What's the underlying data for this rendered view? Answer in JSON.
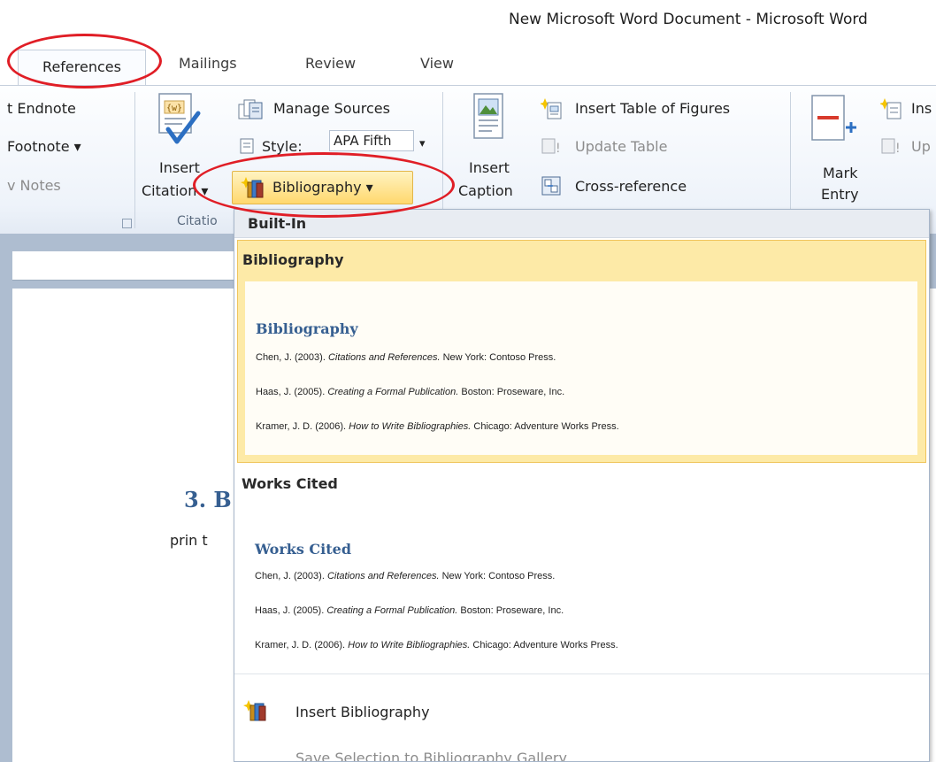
{
  "window": {
    "title": "New Microsoft Word Document  -  Microsoft Word"
  },
  "tabs": [
    {
      "label": "References",
      "active": true
    },
    {
      "label": "Mailings"
    },
    {
      "label": "Review"
    },
    {
      "label": "View"
    }
  ],
  "ribbon": {
    "footnotes": {
      "insert_endnote": "t Endnote",
      "next_footnote": "Footnote ▾",
      "show_notes": "v Notes"
    },
    "citations": {
      "insert_citation_line1": "Insert",
      "insert_citation_line2": "Citation ▾",
      "manage_sources": "Manage Sources",
      "style_label": "Style:",
      "style_value": "APA Fifth",
      "style_arrow": "▾",
      "bibliography": "Bibliography ▾",
      "group_label": "Citatio"
    },
    "captions": {
      "insert_caption_line1": "Insert",
      "insert_caption_line2": "Caption",
      "insert_table_of_figures": "Insert Table of Figures",
      "update_table": "Update Table",
      "cross_reference": "Cross-reference"
    },
    "index": {
      "mark_entry_line1": "Mark",
      "mark_entry_line2": "Entry",
      "insert_index": "Ins",
      "update_index": "Up"
    }
  },
  "document": {
    "heading": "3. B",
    "body": "prin t"
  },
  "dropdown": {
    "section_header": "Built-In",
    "items": [
      {
        "title": "Bibliography",
        "preview_heading": "Bibliography",
        "entries": [
          {
            "before": "Chen, J. (2003). ",
            "italic": "Citations and References.",
            "after": " New York: Contoso Press."
          },
          {
            "before": "Haas, J. (2005). ",
            "italic": "Creating a Formal Publication.",
            "after": " Boston: Proseware, Inc."
          },
          {
            "before": "Kramer, J. D. (2006). ",
            "italic": "How to Write Bibliographies.",
            "after": " Chicago: Adventure Works Press."
          }
        ]
      },
      {
        "title": "Works Cited",
        "preview_heading": "Works Cited",
        "entries": [
          {
            "before": "Chen, J. (2003). ",
            "italic": "Citations and References.",
            "after": " New York: Contoso Press."
          },
          {
            "before": "Haas, J. (2005). ",
            "italic": "Creating a Formal Publication.",
            "after": " Boston: Proseware, Inc."
          },
          {
            "before": "Kramer, J. D. (2006). ",
            "italic": "How to Write Bibliographies.",
            "after": " Chicago: Adventure Works Press."
          }
        ]
      }
    ],
    "insert_bibliography": "Insert Bibliography",
    "save_selection": "Save Selection to Bibliography Gallery..."
  },
  "colors": {
    "accent_heading": "#365f91",
    "selection_highlight": "#fdeaa7",
    "annotation_red": "#e01e26"
  }
}
